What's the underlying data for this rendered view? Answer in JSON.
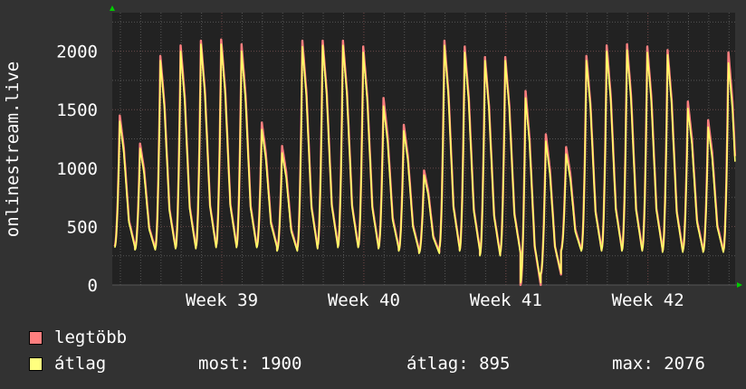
{
  "chart_data": {
    "type": "line",
    "title": "",
    "ylabel": "onlinestream.live",
    "xlabel": "",
    "ylim": [
      0,
      2330
    ],
    "yticks": [
      0,
      500,
      1000,
      1500,
      2000
    ],
    "ytick_labels": [
      "0",
      "500",
      "1000",
      "1500",
      "2000"
    ],
    "xtick_labels": [
      "Week 39",
      "Week 40",
      "Week 41",
      "Week 42"
    ],
    "xtick_days": [
      5.4,
      12.4,
      19.4,
      26.4
    ],
    "x_days_span": 30.7,
    "grid": true,
    "series": [
      {
        "name": "legtöbb",
        "color": "#ff7f7f",
        "daily_peaks": [
          1450,
          1210,
          1960,
          2050,
          2090,
          2100,
          2060,
          1390,
          1190,
          2090,
          2090,
          2090,
          2040,
          1600,
          1370,
          980,
          2090,
          2040,
          1950,
          1950,
          1660,
          1290,
          1180,
          1960,
          2050,
          2060,
          2040,
          2010,
          1570,
          1410,
          1990
        ],
        "daily_troughs": [
          330,
          310,
          320,
          320,
          330,
          340,
          330,
          330,
          300,
          320,
          340,
          330,
          330,
          320,
          300,
          280,
          320,
          300,
          260,
          280,
          0,
          90,
          300,
          300,
          310,
          300,
          310,
          290,
          300,
          290,
          300
        ]
      },
      {
        "name": "átlag",
        "color": "#ffff66",
        "daily_peaks": [
          1400,
          1170,
          1920,
          2000,
          2060,
          2060,
          2000,
          1330,
          1130,
          2040,
          2050,
          2050,
          1990,
          1530,
          1320,
          940,
          2050,
          1990,
          1920,
          1920,
          1600,
          1230,
          1120,
          1920,
          2000,
          2010,
          1990,
          1970,
          1510,
          1350,
          1900
        ],
        "daily_troughs": [
          320,
          300,
          310,
          310,
          320,
          330,
          320,
          320,
          290,
          310,
          330,
          320,
          320,
          310,
          290,
          270,
          310,
          290,
          250,
          270,
          20,
          100,
          290,
          290,
          300,
          290,
          300,
          280,
          290,
          280,
          290
        ]
      }
    ],
    "legend": {
      "max_label": "legtöbb",
      "avg_label": "átlag",
      "now": "most: 1900",
      "average": "átlag: 895",
      "maximum": "max: 2076"
    }
  }
}
